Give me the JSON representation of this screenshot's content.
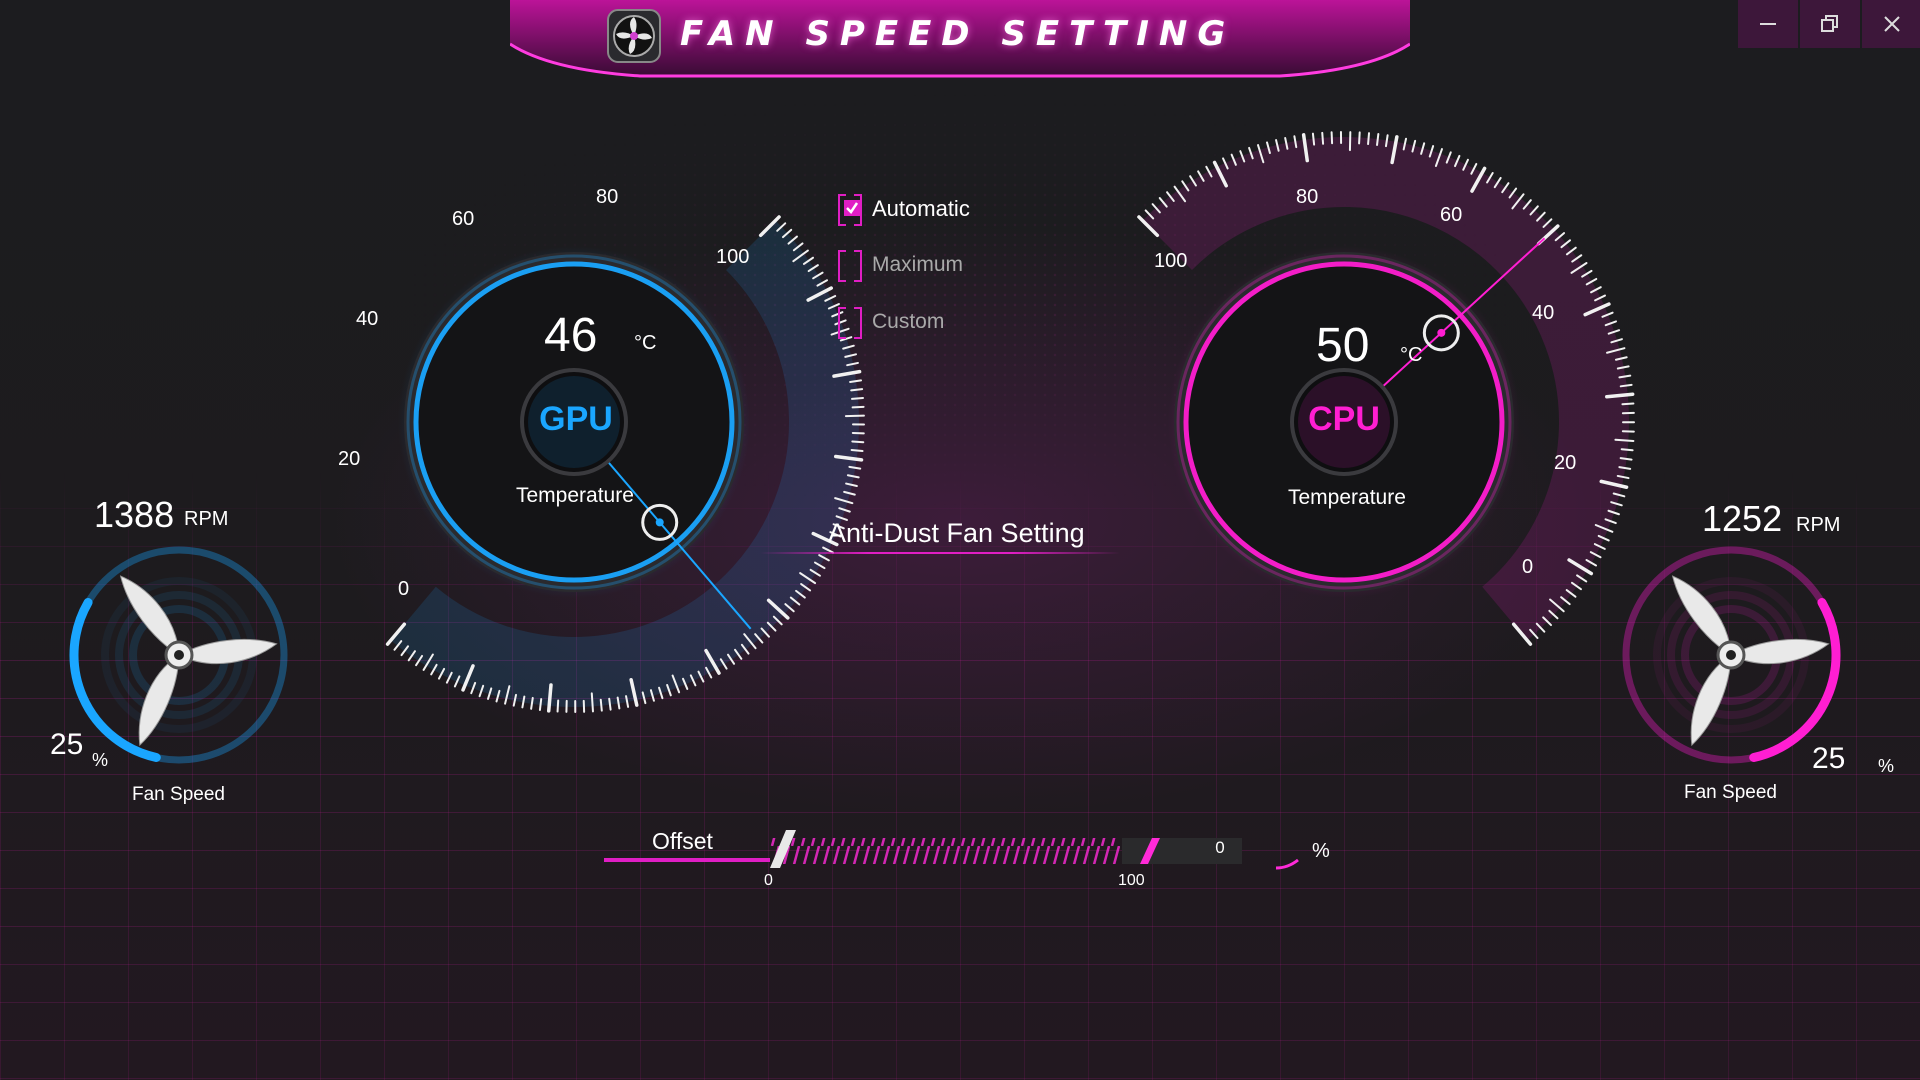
{
  "app": {
    "title": "FAN SPEED SETTING",
    "window_controls": [
      "minimize",
      "restore",
      "close"
    ]
  },
  "colors": {
    "gpu_accent": "#1aa6ff",
    "cpu_accent": "#ff1ed2",
    "brand_magenta": "#e01ec4",
    "background": "#1b1b1d"
  },
  "gpu": {
    "chip_label": "GPU",
    "temperature": "46",
    "temp_unit": "°C",
    "temp_caption": "Temperature",
    "needle_value": 46,
    "scale_min": 0,
    "scale_max": 100,
    "scale_labels": [
      "0",
      "20",
      "40",
      "60",
      "80",
      "100"
    ],
    "fan": {
      "rpm": "1388",
      "rpm_unit": "RPM",
      "percent": "25",
      "percent_unit": "%",
      "percent_value": 25,
      "caption": "Fan Speed"
    }
  },
  "cpu": {
    "chip_label": "CPU",
    "temperature": "50",
    "temp_unit": "°C",
    "temp_caption": "Temperature",
    "needle_value": 50,
    "scale_min": 0,
    "scale_max": 100,
    "scale_labels": [
      "0",
      "20",
      "40",
      "60",
      "80",
      "100"
    ],
    "fan": {
      "rpm": "1252",
      "rpm_unit": "RPM",
      "percent": "25",
      "percent_unit": "%",
      "percent_value": 25,
      "caption": "Fan Speed"
    }
  },
  "modes": [
    {
      "label": "Automatic",
      "checked": true
    },
    {
      "label": "Maximum",
      "checked": false
    },
    {
      "label": "Custom",
      "checked": false
    }
  ],
  "anti_dust": {
    "label": "Anti-Dust Fan Setting"
  },
  "offset": {
    "label": "Offset",
    "value": "0",
    "unit": "%",
    "min_label": "0",
    "max_label": "100",
    "position": 0
  }
}
